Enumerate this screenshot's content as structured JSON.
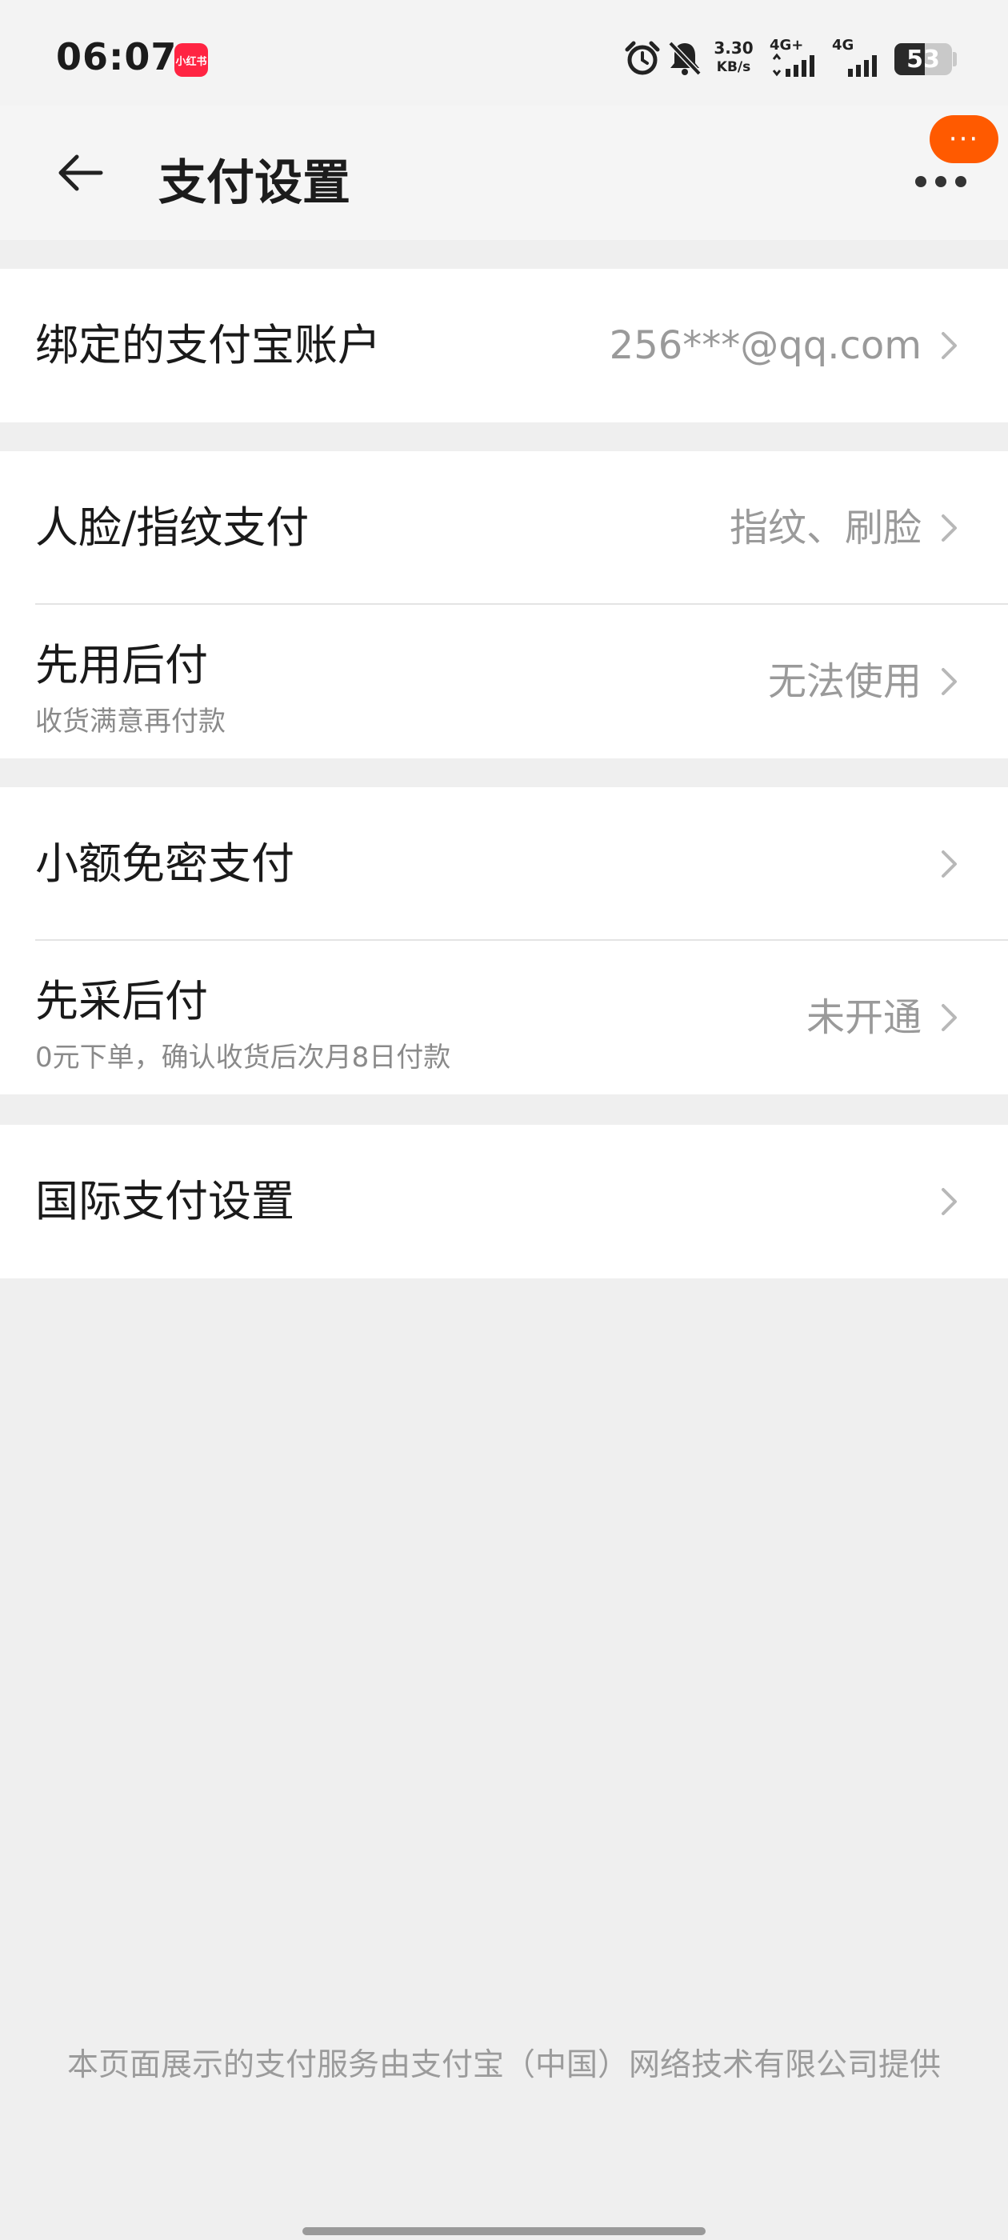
{
  "status_bar": {
    "time": "06:07",
    "app_badge": "小红书",
    "net_speed": "3.30",
    "net_unit": "KB/s",
    "sim1_label": "4G+",
    "sim2_label": "4G",
    "battery_level": "53",
    "icons": [
      "alarm-icon",
      "bell-muted-icon",
      "signal-icon",
      "signal-icon",
      "battery-icon"
    ]
  },
  "header": {
    "title": "支付设置",
    "back_icon": "arrow-left-icon",
    "more_icon": "more-dots-icon",
    "floating_badge": "···"
  },
  "groups": [
    {
      "rows": [
        {
          "title": "绑定的支付宝账户",
          "value": "256***@qq.com"
        }
      ]
    },
    {
      "rows": [
        {
          "title": "人脸/指纹支付",
          "value": "指纹、刷脸"
        },
        {
          "title": "先用后付",
          "subtitle": "收货满意再付款",
          "value": "无法使用"
        }
      ]
    },
    {
      "rows": [
        {
          "title": "小额免密支付",
          "value": ""
        },
        {
          "title": "先采后付",
          "subtitle": "0元下单，确认收货后次月8日付款",
          "value": "未开通"
        }
      ]
    },
    {
      "rows": [
        {
          "title": "国际支付设置",
          "value": ""
        }
      ]
    }
  ],
  "footer": {
    "note": "本页面展示的支付服务由支付宝（中国）网络技术有限公司提供"
  },
  "colors": {
    "accent_orange": "#ff5a00",
    "badge_red": "#ff2442",
    "page_bg": "#efefef",
    "card_bg": "#ffffff",
    "value_gray": "#9a9a9a"
  }
}
